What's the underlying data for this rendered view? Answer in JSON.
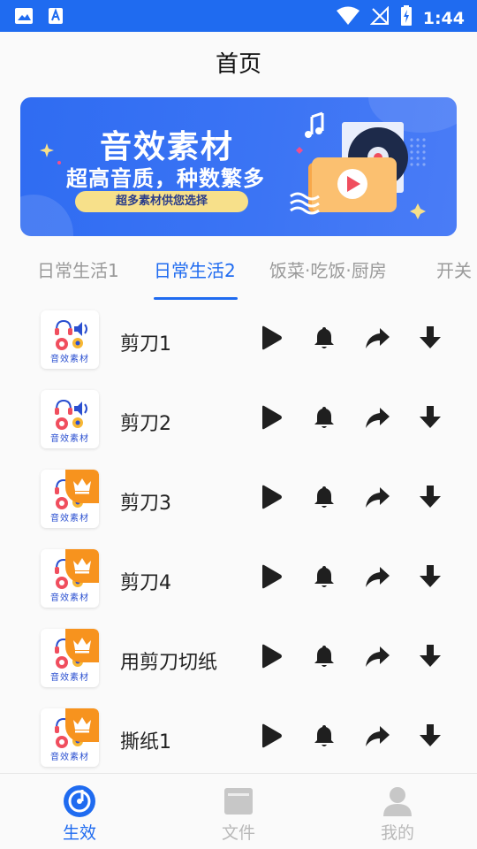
{
  "status_bar": {
    "time": "1:44",
    "left_icons": [
      "image-icon",
      "text-a-icon"
    ],
    "right_icons": [
      "wifi-icon",
      "no-signal-icon",
      "battery-charging-icon"
    ]
  },
  "header": {
    "title": "首页"
  },
  "banner": {
    "title": "音效素材",
    "subtitle": "超高音质，种数繁多",
    "pill_text": "超多素材供您选择"
  },
  "tabs": [
    {
      "label": "日常生活1",
      "active": false
    },
    {
      "label": "日常生活2",
      "active": true
    },
    {
      "label": "饭菜·吃饭·厨房",
      "active": false
    },
    {
      "label": "开关",
      "active": false
    }
  ],
  "thumb_caption": "音效素材",
  "sounds": [
    {
      "name": "剪刀1",
      "premium": false
    },
    {
      "name": "剪刀2",
      "premium": false
    },
    {
      "name": "剪刀3",
      "premium": true
    },
    {
      "name": "剪刀4",
      "premium": true
    },
    {
      "name": "用剪刀切纸",
      "premium": true
    },
    {
      "name": "撕纸1",
      "premium": true
    }
  ],
  "row_actions": [
    "play-icon",
    "bell-icon",
    "share-icon",
    "download-icon"
  ],
  "bottom_nav": [
    {
      "label": "生效",
      "icon": "music-disc-icon",
      "active": true
    },
    {
      "label": "文件",
      "icon": "folder-icon",
      "active": false
    },
    {
      "label": "我的",
      "icon": "user-icon",
      "active": false
    }
  ],
  "colors": {
    "primary": "#1f6bf0",
    "accent": "#f7931e",
    "pill": "#f7e08a"
  }
}
